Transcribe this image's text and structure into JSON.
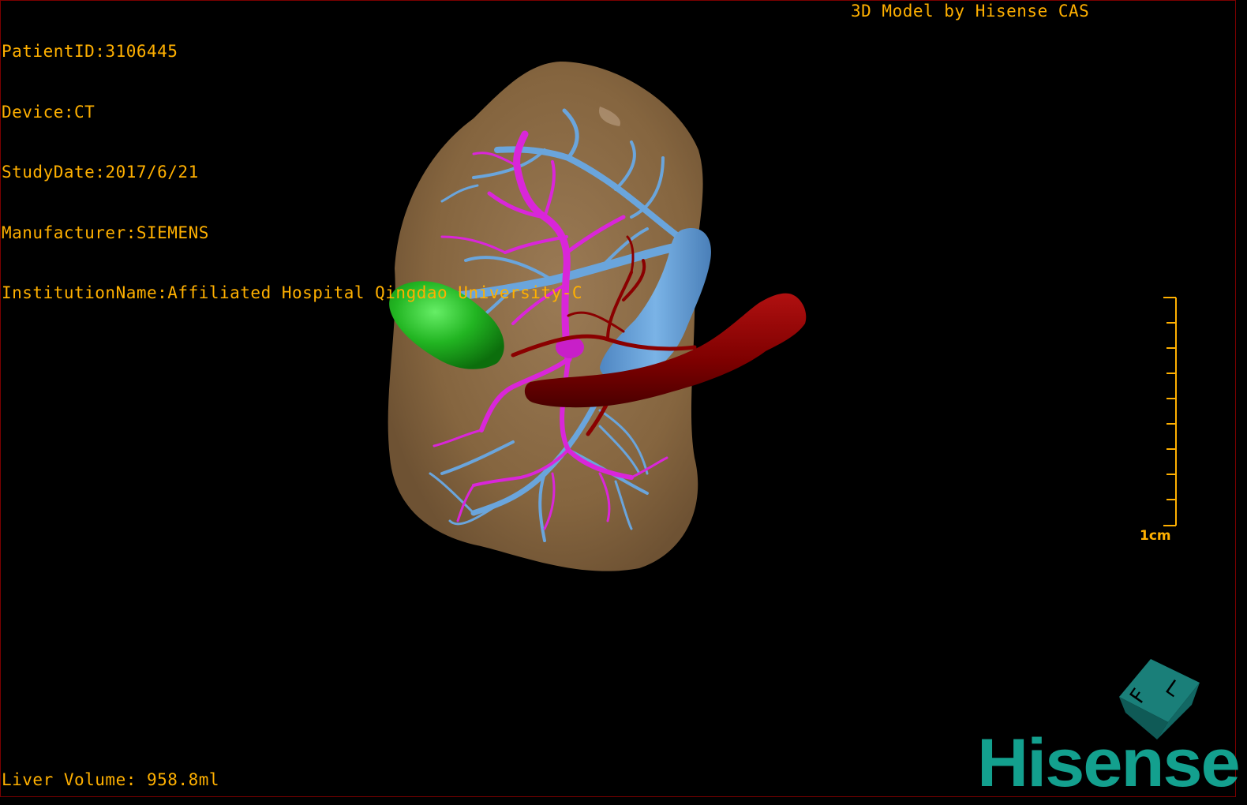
{
  "info": {
    "patient_id": "PatientID:3106445",
    "device": "Device:CT",
    "study_date": "StudyDate:2017/6/21",
    "manufacturer": "Manufacturer:SIEMENS",
    "institution": "InstitutionName:Affiliated Hospital Qingdao University-C"
  },
  "header": {
    "brand": "3D Model by Hisense CAS"
  },
  "footer": {
    "liver_volume": "Liver Volume: 958.8ml"
  },
  "scale_bar": {
    "label": "1cm",
    "ticks": 10
  },
  "orientation_cube": {
    "face_letters": [
      "F",
      "L"
    ]
  },
  "logo": {
    "text": "Hisense"
  },
  "colors": {
    "text": "#ffb000",
    "liver": "#8b6b48",
    "portal_vein": "#6aa5dc",
    "hepatic_vein": "#d926d9",
    "artery": "#8a0000",
    "gallbladder": "#1fa31f",
    "logo": "#13a08e"
  }
}
